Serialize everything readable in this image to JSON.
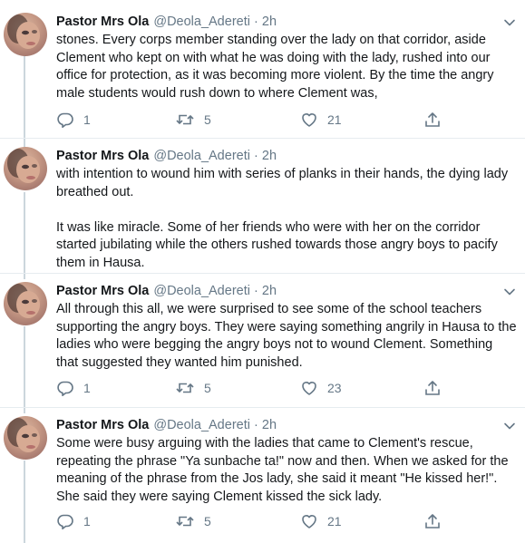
{
  "tweets": [
    {
      "name": "Pastor Mrs Ola",
      "handle": "@Deola_Adereti",
      "dot": "·",
      "time": "2h",
      "text": "stones. Every corps member standing over the lady on that corridor, aside Clement who kept on with what he was doing with the lady, rushed into our office for protection, as it was becoming more violent.  By the time the angry male students would rush down to where Clement was,",
      "replies": "1",
      "retweets": "5",
      "likes": "21"
    },
    {
      "name": "Pastor Mrs Ola",
      "handle": "@Deola_Adereti",
      "dot": "·",
      "time": "2h",
      "text": "with intention to wound him with series of planks in their hands, the dying lady breathed out.\n\nIt was like miracle. Some of her friends who were with her on the corridor started jubilating while the others rushed towards those angry boys to pacify them in Hausa.",
      "replies": "",
      "retweets": "",
      "likes": ""
    },
    {
      "name": "Pastor Mrs Ola",
      "handle": "@Deola_Adereti",
      "dot": "·",
      "time": "2h",
      "text": "All through this all, we were surprised to see some of the school teachers supporting the angry boys.  They were saying something angrily in Hausa to the ladies who were begging the angry boys not to wound Clement. Something that suggested they wanted him punished.",
      "replies": "1",
      "retweets": "5",
      "likes": "23"
    },
    {
      "name": "Pastor Mrs Ola",
      "handle": "@Deola_Adereti",
      "dot": "·",
      "time": "2h",
      "text": "Some were busy arguing with the ladies that came to Clement's rescue, repeating the phrase \"Ya sunbache ta!\" now and then. When we asked for the meaning of the phrase from the Jos lady, she said it meant \"He kissed her!\". She said they were saying Clement kissed the sick lady.",
      "replies": "1",
      "retweets": "5",
      "likes": "21"
    }
  ],
  "icons": {
    "reply": "reply-icon",
    "retweet": "retweet-icon",
    "like": "heart-icon",
    "share": "share-icon",
    "menu": "chevron-down-icon"
  },
  "colors": {
    "text": "#14171a",
    "muted": "#657786",
    "divider": "#e6ecf0",
    "thread": "#ccd6dd"
  }
}
